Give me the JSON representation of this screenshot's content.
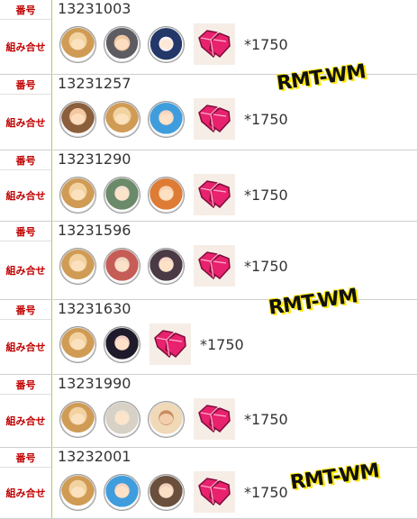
{
  "labels": {
    "number": "番号",
    "combination": "組み合せ"
  },
  "rows": [
    {
      "id": "13231003",
      "quantity": "*1750",
      "avatars": [
        "cat-knight-avatar",
        "crown-king-avatar",
        "skull-mage-avatar"
      ]
    },
    {
      "id": "13231257",
      "quantity": "*1750",
      "avatars": [
        "brown-hair-avatar",
        "cat-knight-avatar",
        "blue-sprite-avatar"
      ]
    },
    {
      "id": "13231290",
      "quantity": "*1750",
      "avatars": [
        "cat-knight-avatar",
        "green-elf-avatar",
        "orange-girl-avatar"
      ]
    },
    {
      "id": "13231596",
      "quantity": "*1750",
      "avatars": [
        "cat-knight-avatar",
        "flower-shrine-avatar",
        "rabbit-girl-avatar"
      ]
    },
    {
      "id": "13231630",
      "quantity": "*1750",
      "avatars": [
        "cat-knight-avatar",
        "black-hair-avatar"
      ]
    },
    {
      "id": "13231990",
      "quantity": "*1750",
      "avatars": [
        "cat-knight-avatar",
        "white-beard-avatar",
        "tan-girl-avatar"
      ]
    },
    {
      "id": "13232001",
      "quantity": "*1750",
      "avatars": [
        "cat-knight-avatar",
        "blue-sprite-avatar",
        "brown-girl-avatar"
      ]
    }
  ],
  "watermark": "RMT-WM"
}
